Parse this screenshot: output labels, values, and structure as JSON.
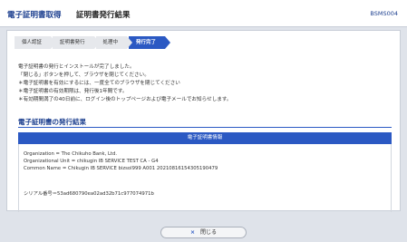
{
  "header": {
    "app_title": "電子証明書取得",
    "page_title": "証明書発行結果",
    "screen_id": "BSMS004"
  },
  "steps": [
    {
      "label": "個人認証",
      "active": false
    },
    {
      "label": "証明書発行",
      "active": false
    },
    {
      "label": "処理中",
      "active": false
    },
    {
      "label": "発行完了",
      "active": true
    }
  ],
  "message": {
    "line1": "電子証明書の発行とインストールが完了しました。",
    "line2": "「閉じる」ボタンを押して、ブラウザを閉じてください。",
    "line3": "＊電子証明書を有効にするには、一度全てのブラウザを閉じてください",
    "line4": "＊電子証明書の有効期限は、発行後1年間です。",
    "line5": "＊有効期間満了の40日前に、ログイン後のトップページおよび電子メールでお知らせします。"
  },
  "result": {
    "section_title": "電子証明書の発行結果",
    "table_header": "電子証明書情報",
    "organization": "Organization = The Chikuho Bank, Ltd.",
    "org_unit": "Organizational Unit = chikugin IB SERVICE TEST CA - G4",
    "common_name": "Common Name = Chikugin IB SERVICE bizsol999 A001 20210816154305190479",
    "serial": "シリアル番号＝53ad680790ea02ad32b71c977074971b"
  },
  "footer": {
    "close_label": "閉じる",
    "close_glyph": "×"
  },
  "colors": {
    "accent": "#2b59c3",
    "title": "#1c3f8f",
    "background": "#dfe3ea"
  }
}
